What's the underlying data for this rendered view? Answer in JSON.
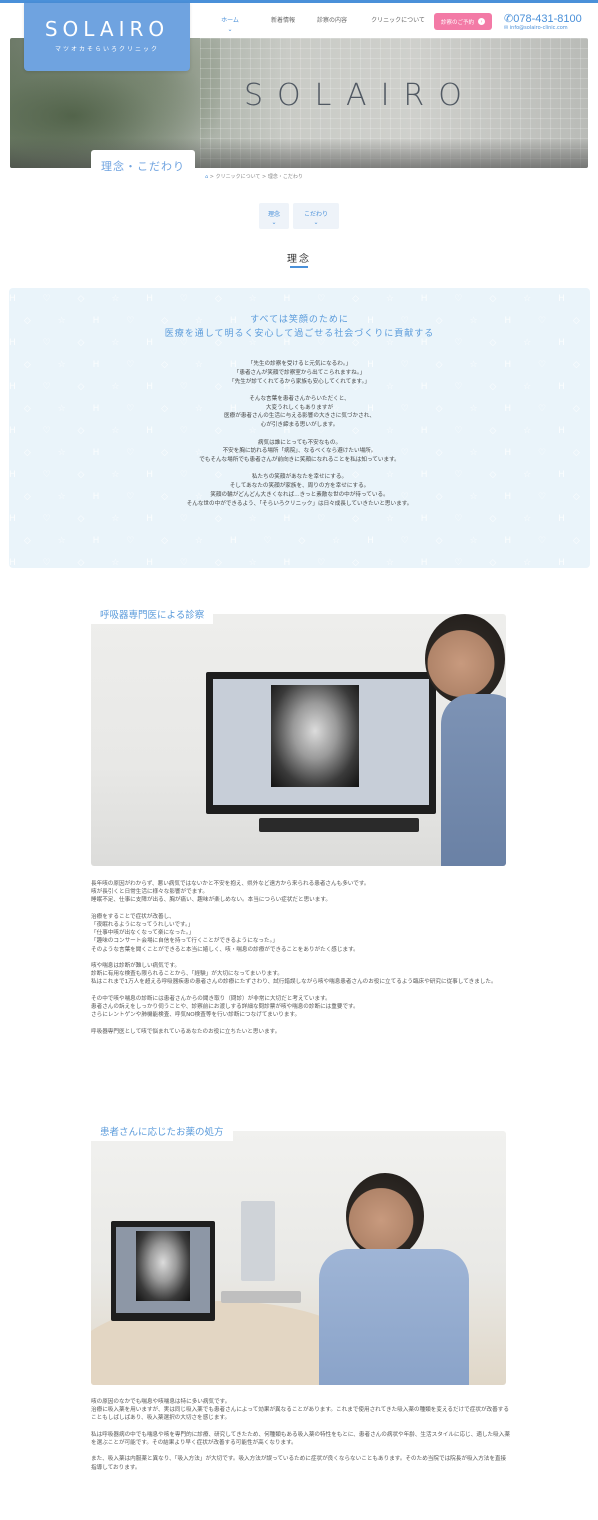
{
  "header": {
    "logo": "SOLAIRO",
    "logo_sub": "マツオカそらいろクリニック",
    "nav": [
      {
        "label": "ホーム",
        "active": true
      },
      {
        "label": "新着情報",
        "active": false
      },
      {
        "label": "診察の内容",
        "active": false
      },
      {
        "label": "クリニックについて",
        "active": false
      }
    ],
    "reserve_label": "診察のご予約",
    "phone": "078-431-8100",
    "email": "info@solairo-clinic.com"
  },
  "hero": {
    "word": "SOLAIRO",
    "page_title": "理念・こだわり",
    "breadcrumb": {
      "home_icon": "home-icon",
      "parent": "クリニックについて",
      "current": "理念・こだわり",
      "sep": ">"
    }
  },
  "tabs": [
    {
      "label": "理念"
    },
    {
      "label": "こだわり"
    }
  ],
  "section_title": "理念",
  "philosophy": {
    "head_line1": "すべては笑顔のために",
    "head_line2": "医療を通して明るく安心して過ごせる社会づくりに貢献する",
    "paragraphs": [
      [
        "「先生の診察を受けると元気になるわ。」",
        "「患者さんが笑顔で診察室から出てこられますね。」",
        "「先生が診てくれてるから家族も安心してくれてます。」"
      ],
      [
        "そんな言葉を患者さんからいただくと、",
        "大変うれしくもありますが",
        "医療が患者さんの生活に与える影響の大きさに気づかされ、",
        "心が引き締まる思いがします。"
      ],
      [
        "病気は誰にとっても不安なもの。",
        "不安を胸に訪れる場所「病院」、なるべくなら避けたい場所。",
        "でもそんな場所でも患者さんが前向きに笑顔になれることを私は知っています。"
      ],
      [
        "私たちの笑顔があなたを幸せにする。",
        "そしてあなたの笑顔が家族を、周りの方を幸せにする。",
        "笑顔の輪がどんどん大きくなれば…きっと素敵な世の中が待っている。",
        "そんな世の中ができるよう、「そらいろクリニック」は日々成長していきたいと思います。"
      ]
    ]
  },
  "feature1": {
    "title": "呼吸器専門医による診察",
    "paragraphs": [
      [
        "長年咳の原因がわからず、悪い病気ではないかと不安を抱え、県外など遠方から来られる患者さんも多いです。",
        "咳が長引くと日常生活に様々な影響がでます。",
        "睡眠不足、仕事に支障が出る、胸が痛い、趣味が楽しめない。本当につらい症状だと思います。"
      ],
      [
        "治療をすることで症状が改善し、",
        "「夜眠れるようになってうれしいです。」",
        "「仕事中咳が出なくなって楽になった。」",
        "「趣味のコンサート会場に自信を持って行くことができるようになった。」",
        "そのような言葉を聞くことができると本当に嬉しく、咳・喘息の診療ができることをありがたく感じます。"
      ],
      [
        "咳や喘息は診断が難しい病気です。",
        "診断に有用な検査も限られることから、「経験」が大切になってまいります。",
        "私はこれまで1万人を超える呼吸器疾患の患者さんの診療にたずさわり、試行錯誤しながら咳や喘息患者さんのお役に立てるよう臨床や研究に従事してきました。"
      ],
      [
        "その中で咳や喘息の診断には患者さんからの聞き取り（問診）が非常に大切だと考えています。",
        "患者さんの訴えをしっかり伺うことや、診察前にお渡しする詳細な問診票が咳や喘息の診断には重要です。",
        "さらにレントゲンや肺機能検査、呼気NO検査等を行い診断につなげてまいります。"
      ],
      [
        "呼吸器専門医として咳で悩まれているあなたのお役に立ちたいと思います。"
      ]
    ]
  },
  "feature2": {
    "title": "患者さんに応じたお薬の処方",
    "paragraphs": [
      [
        "咳の原因のなかでも喘息や咳喘息は特に多い病気です。",
        "治療に吸入薬を用いますが、実は同じ吸入薬でも患者さんによって効果が異なることがあります。これまで使用されてきた吸入薬の種類を変えるだけで症状が改善することもしばしばあり、吸入薬選択の大切さを感じます。"
      ],
      [
        "私は呼吸器病の中でも喘息や咳を専門的に診療、研究してきたため、何種類もある吸入薬の特性をもとに、患者さんの病状や年齢、生活スタイルに応じ、適した吸入薬を選ぶことが可能です。その結果より早く症状が改善する可能性が高くなります。"
      ],
      [
        "また、吸入薬は内服薬と異なり、「吸入方法」が大切です。吸入方法が誤っているために症状が良くならないこともあります。そのため当院では院長が吸入方法を直接指導しております。"
      ]
    ]
  },
  "colors": {
    "accent": "#4a90d9",
    "logo_bg": "#6fa3e0",
    "reserve": "#f37aa6",
    "philo_bg": "#eaf4fa"
  }
}
